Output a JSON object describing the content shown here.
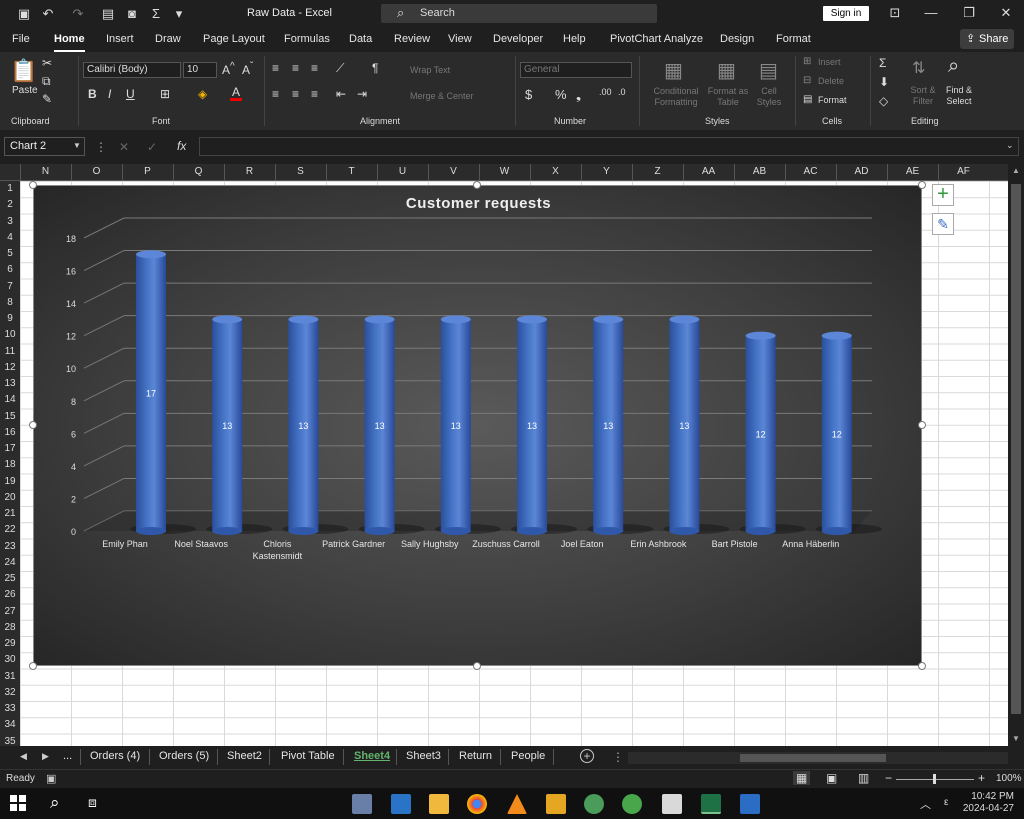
{
  "window": {
    "title": "Raw Data  -  Excel",
    "search_placeholder": "Search",
    "signin": "Sign in"
  },
  "menu": {
    "tabs": [
      "File",
      "Home",
      "Insert",
      "Draw",
      "Page Layout",
      "Formulas",
      "Data",
      "Review",
      "View",
      "Developer",
      "Help",
      "PivotChart Analyze",
      "Design",
      "Format"
    ],
    "active": "Home",
    "share": "Share"
  },
  "ribbon": {
    "clipboard": {
      "label": "Clipboard",
      "paste": "Paste"
    },
    "font": {
      "label": "Font",
      "name": "Calibri (Body)",
      "size": "10"
    },
    "alignment": {
      "label": "Alignment",
      "wrap": "Wrap Text",
      "merge": "Merge & Center"
    },
    "number": {
      "label": "Number",
      "format": "General"
    },
    "styles": {
      "label": "Styles",
      "conditional": "Conditional Formatting",
      "format_table": "Format as Table",
      "cell_styles": "Cell Styles"
    },
    "cells": {
      "label": "Cells",
      "insert": "Insert",
      "delete": "Delete",
      "format": "Format"
    },
    "editing": {
      "label": "Editing",
      "sort": "Sort & Filter",
      "find": "Find & Select"
    }
  },
  "formula": {
    "name_box": "Chart 2",
    "fx": "fx"
  },
  "columns": [
    "N",
    "O",
    "P",
    "Q",
    "R",
    "S",
    "T",
    "U",
    "V",
    "W",
    "X",
    "Y",
    "Z",
    "AA",
    "AB",
    "AC",
    "AD",
    "AE",
    "AF"
  ],
  "rows": [
    "1",
    "2",
    "3",
    "4",
    "5",
    "6",
    "7",
    "8",
    "9",
    "10",
    "11",
    "12",
    "13",
    "14",
    "15",
    "16",
    "17",
    "18",
    "19",
    "20",
    "21",
    "22",
    "23",
    "24",
    "25",
    "26",
    "27",
    "28",
    "29",
    "30",
    "31",
    "32",
    "33",
    "34",
    "35"
  ],
  "chart_data": {
    "type": "bar",
    "title": "Customer requests",
    "categories": [
      "Emily Phan",
      "Noel Staavos",
      "Chloris Kastensmidt",
      "Patrick Gardner",
      "Sally Hughsby",
      "Zuschuss Carroll",
      "Joel Eaton",
      "Erin Ashbrook",
      "Bart Pistole",
      "Anna Häberlin"
    ],
    "values": [
      17,
      13,
      13,
      13,
      13,
      13,
      13,
      13,
      12,
      12
    ],
    "ylim": [
      0,
      18
    ],
    "yticks": [
      "0",
      "2",
      "4",
      "6",
      "8",
      "10",
      "12",
      "14",
      "16",
      "18"
    ],
    "color": "#4472c4",
    "grid": true,
    "data_labels": true
  },
  "sheets": {
    "tabs": [
      "...",
      "Orders (4)",
      "Orders (5)",
      "Sheet2",
      "Pivot Table",
      "Sheet4",
      "Sheet3",
      "Return",
      "People"
    ],
    "active": "Sheet4"
  },
  "status": {
    "ready": "Ready",
    "zoom": "100%"
  },
  "taskbar": {
    "time": "10:42 PM",
    "date": "2024-04-27"
  }
}
